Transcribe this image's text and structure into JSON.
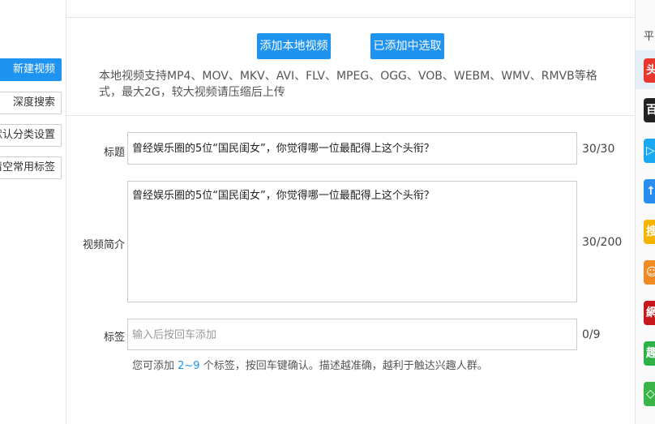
{
  "left_buttons": [
    {
      "label": "新建视频",
      "primary": true
    },
    {
      "label": "深度搜索",
      "primary": false
    },
    {
      "label": "默认分类设置",
      "primary": false
    },
    {
      "label": "清空常用标签",
      "primary": false
    }
  ],
  "upload": {
    "add_local_label": "添加本地视频",
    "select_added_label": "已添加中选取",
    "note": "本地视频支持MP4、MOV、MKV、AVI、FLV、MPEG、OGG、VOB、WEBM、WMV、RMVB等格式，最大2G，较大视频请压缩后上传"
  },
  "form": {
    "title_label": "标题",
    "title_value": "曾经娱乐圈的5位“国民闺女”，你觉得哪一位最配得上这个头衔？",
    "title_count": "30/30",
    "desc_label": "视频简介",
    "desc_value": "曾经娱乐圈的5位“国民闺女”，你觉得哪一位最配得上这个头衔？",
    "desc_count": "30/200",
    "tags_label": "标签",
    "tags_placeholder": "输入后按回车添加",
    "tags_count": "0/9",
    "hint_prefix": "您可添加 ",
    "hint_range": "2~9",
    "hint_suffix": " 个标签，按回车键确认。描述越准确，越利于触达兴趣人群。"
  },
  "right_panel": {
    "header": "平",
    "platforms": [
      {
        "icon": "toutiao-icon",
        "glyph": "头",
        "color": "#e8362f"
      },
      {
        "icon": "baijia-icon",
        "glyph": "百",
        "color": "#222222"
      },
      {
        "icon": "play-icon",
        "glyph": "▷",
        "color": "#1aa8f0"
      },
      {
        "icon": "upload-arrow-icon",
        "glyph": "↑",
        "color": "#2a8ef0"
      },
      {
        "icon": "sohu-icon",
        "glyph": "搜",
        "color": "#f5b400"
      },
      {
        "icon": "fox-icon",
        "glyph": "☺",
        "color": "#f08a24"
      },
      {
        "icon": "netease-icon",
        "glyph": "網",
        "color": "#c8171d"
      },
      {
        "icon": "qutoutiao-icon",
        "glyph": "趣",
        "color": "#2fb14a"
      },
      {
        "icon": "diamond-icon",
        "glyph": "◇",
        "color": "#3bb54a"
      }
    ]
  }
}
